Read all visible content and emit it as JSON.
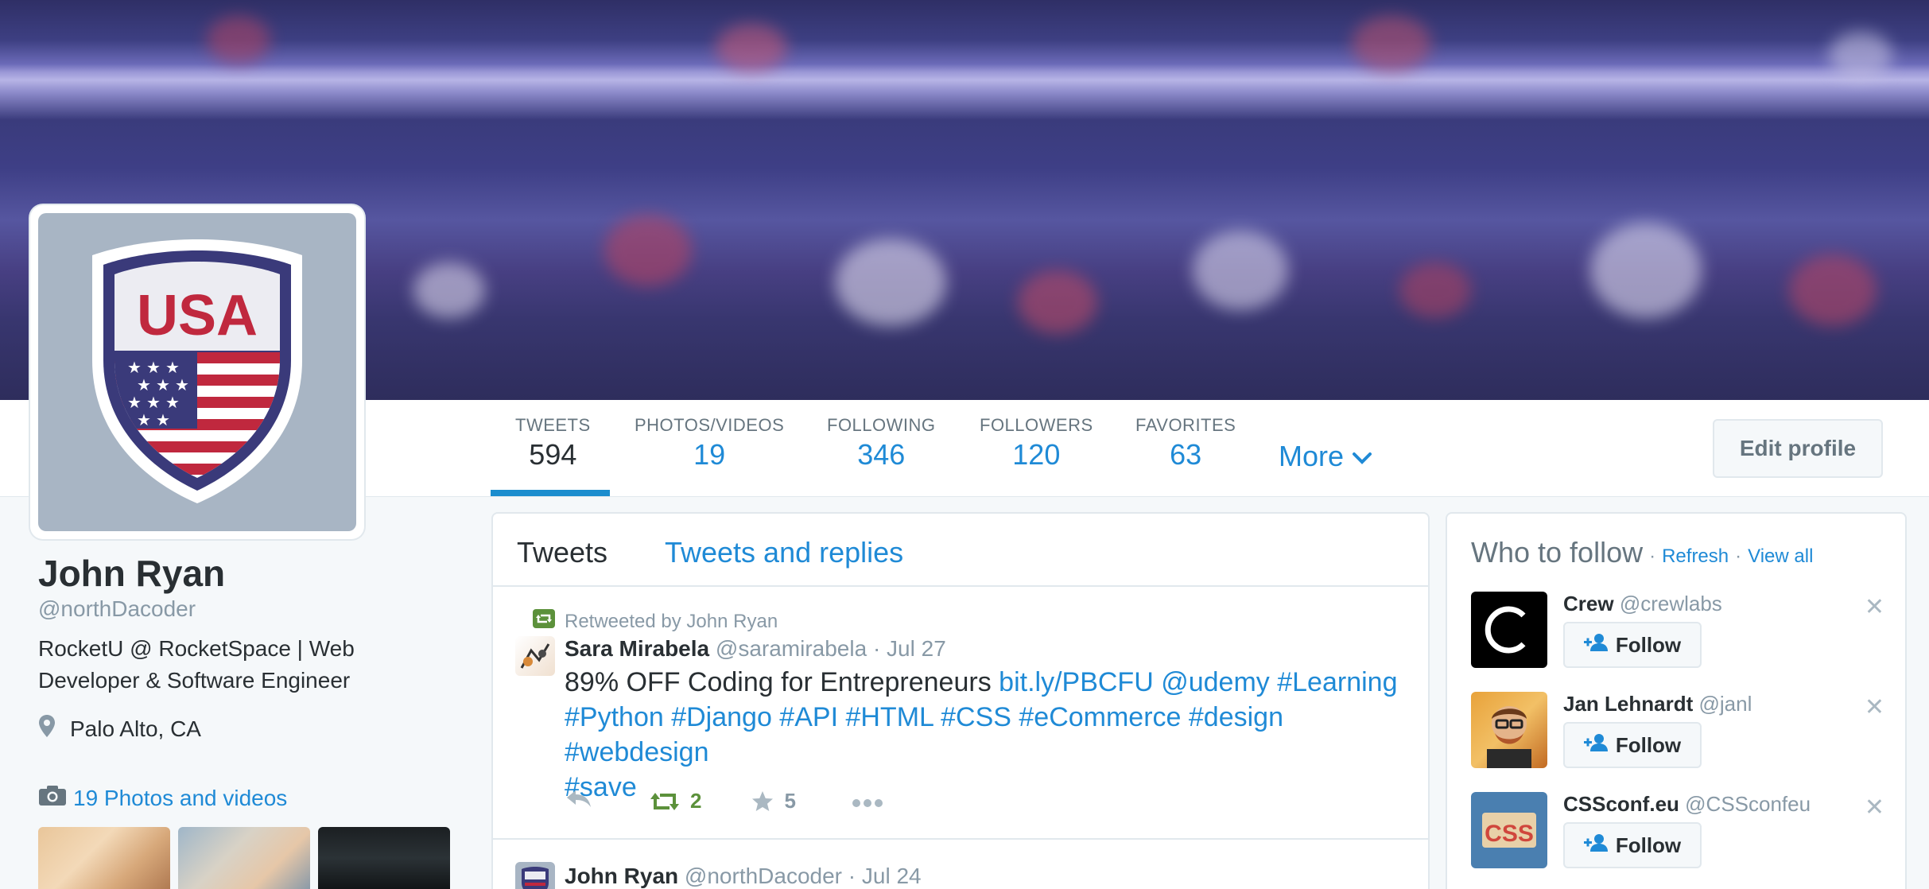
{
  "profile": {
    "name": "John Ryan",
    "handle": "@northDacoder",
    "bio": "RocketU @ RocketSpace | Web Developer & Software Engineer",
    "location": "Palo Alto, CA",
    "photos_link": "19 Photos and videos",
    "avatar_text": "USA"
  },
  "nav": {
    "stats": [
      {
        "label": "TWEETS",
        "value": "594"
      },
      {
        "label": "PHOTOS/VIDEOS",
        "value": "19"
      },
      {
        "label": "FOLLOWING",
        "value": "346"
      },
      {
        "label": "FOLLOWERS",
        "value": "120"
      },
      {
        "label": "FAVORITES",
        "value": "63"
      }
    ],
    "more": "More",
    "edit_profile": "Edit profile"
  },
  "timeline": {
    "tabs": [
      "Tweets",
      "Tweets and replies"
    ],
    "tweets": [
      {
        "retweeted_by": "Retweeted by John Ryan",
        "author": "Sara Mirabela",
        "handle": "@saramirabela",
        "date": "· Jul 27",
        "text_plain": "89% OFF Coding for Entrepreneurs ",
        "link": "bit.ly/PBCFU",
        "mention": "@udemy",
        "hashtags_line1": "#Learning",
        "hashtags_line2": "#Python #Django #API #HTML #CSS #eCommerce #design #webdesign",
        "hashtags_line3": "#save",
        "retweets": "2",
        "favorites": "5"
      },
      {
        "author": "John Ryan",
        "handle": "@northDacoder",
        "date": "· Jul 24"
      }
    ]
  },
  "who_to_follow": {
    "title": "Who to follow",
    "refresh": "Refresh",
    "view_all": "View all",
    "sep": "·",
    "follow_label": "Follow",
    "users": [
      {
        "name": "Crew",
        "handle": "@crewlabs"
      },
      {
        "name": "Jan Lehnardt",
        "handle": "@janl"
      },
      {
        "name": "CSSconf.eu",
        "handle": "@CSSconfeu",
        "avatar_text": "CSS"
      }
    ]
  },
  "colors": {
    "link": "#1f8ad6",
    "retweet_green": "#5c913b",
    "tab_underline": "#1b8dce"
  }
}
